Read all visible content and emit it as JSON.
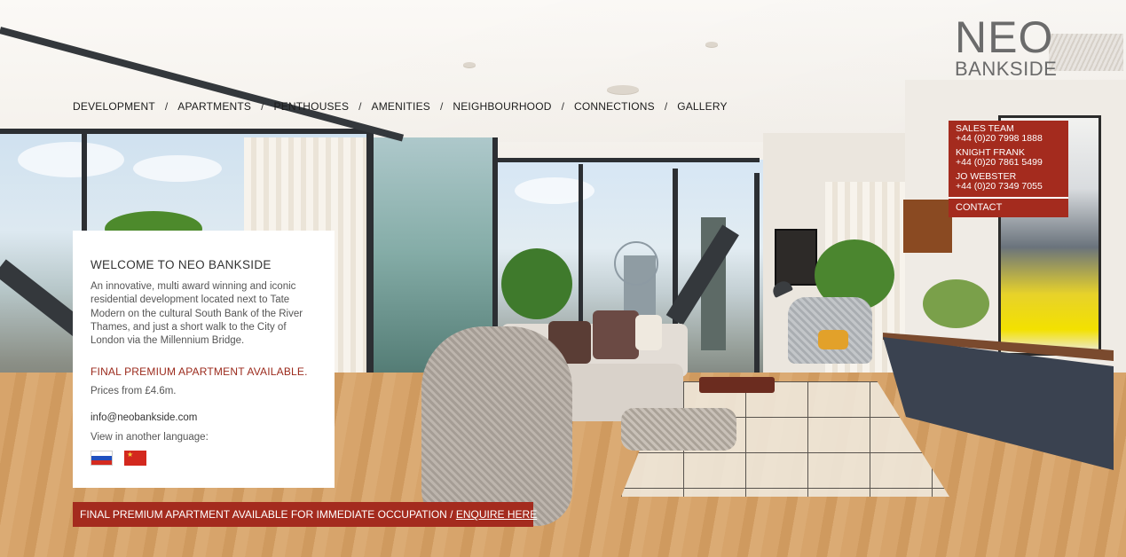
{
  "brand": {
    "line1": "NEO",
    "line2": "BANKSIDE"
  },
  "nav": {
    "items": [
      {
        "label": "DEVELOPMENT"
      },
      {
        "label": "APARTMENTS"
      },
      {
        "label": "PENTHOUSES"
      },
      {
        "label": "AMENITIES"
      },
      {
        "label": "NEIGHBOURHOOD"
      },
      {
        "label": "CONNECTIONS"
      },
      {
        "label": "GALLERY"
      }
    ],
    "separator": "/"
  },
  "contacts": {
    "groups": [
      {
        "name": "SALES TEAM",
        "phone": "+44 (0)20 7998 1888"
      },
      {
        "name": "KNIGHT FRANK",
        "phone": "+44 (0)20 7861 5499"
      },
      {
        "name": "JO WEBSTER",
        "phone": "+44 (0)20 7349 7055"
      }
    ],
    "contact_label": "CONTACT"
  },
  "welcome": {
    "title": "WELCOME TO NEO BANKSIDE",
    "description": "An innovative, multi award winning and iconic residential development located next to Tate Modern on the cultural South Bank of the River Thames, and just a short walk to the City of London via the Millennium Bridge.",
    "premium": "FINAL PREMIUM APARTMENT AVAILABLE.",
    "price": "Prices from £4.6m.",
    "email": "info@neobankside.com",
    "language_prompt": "View in another language:",
    "flags": [
      {
        "icon": "russia-flag-icon"
      },
      {
        "icon": "china-flag-icon"
      }
    ]
  },
  "banner": {
    "text": "FINAL PREMIUM APARTMENT AVAILABLE FOR IMMEDIATE OCCUPATION / ",
    "link": "ENQUIRE HERE"
  },
  "colors": {
    "accent_red": "#a42b1e",
    "premium_text": "#9b2a1c",
    "logo_grey": "#6b6b6b"
  }
}
